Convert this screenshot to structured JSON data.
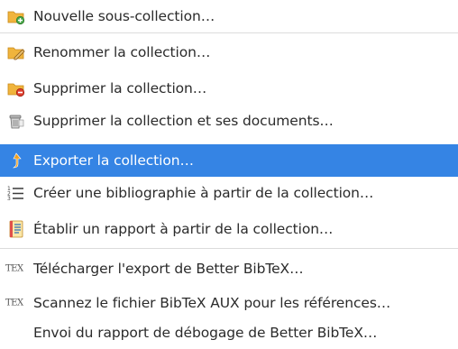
{
  "menu": {
    "items": [
      {
        "label": "Nouvelle sous-collection…",
        "icon": "new-subcollection-icon"
      },
      {
        "label": "Renommer la collection…",
        "icon": "rename-folder-icon"
      },
      {
        "label": "Supprimer la collection…",
        "icon": "delete-folder-icon"
      },
      {
        "label": "Supprimer la collection et ses documents…",
        "icon": "trash-icon"
      },
      {
        "label": "Exporter la collection…",
        "icon": "export-arrow-icon",
        "highlighted": true
      },
      {
        "label": "Créer une bibliographie à partir de la collection…",
        "icon": "bibliography-list-icon"
      },
      {
        "label": "Établir un rapport à partir de la collection…",
        "icon": "report-icon"
      },
      {
        "label": "Télécharger l'export de Better BibTeX…",
        "icon": "tex-icon"
      },
      {
        "label": "Scannez le fichier BibTeX AUX pour les références…",
        "icon": "tex-icon"
      },
      {
        "label": "Envoi du rapport de débogage de Better BibTeX…",
        "icon": ""
      }
    ],
    "tex_icon_text": "TEX",
    "highlight_color": "#3584e4"
  }
}
